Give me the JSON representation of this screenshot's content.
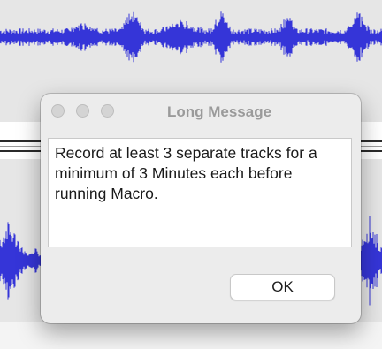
{
  "background": {
    "waveform_color": "#3535d8",
    "track_background": "#e6e6e6",
    "separator_color": "#2a2a2a"
  },
  "dialog": {
    "title": "Long Message",
    "message": "Record at least 3 separate tracks for a minimum of 3 Minutes each before running Macro.",
    "ok_label": "OK",
    "window_buttons": [
      "close-icon",
      "minimize-icon",
      "zoom-icon"
    ]
  }
}
